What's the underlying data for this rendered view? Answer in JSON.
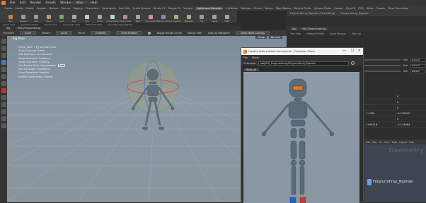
{
  "menubar": {
    "items": [
      "File",
      "Edit",
      "Render",
      "Assets",
      "Windows",
      "Labs",
      "Help"
    ],
    "build": "Build",
    "title": "Main"
  },
  "shelf_tabs": [
    "Create",
    "Modify",
    "Model",
    "Polygon",
    "Deform",
    "Texture",
    "Rigging",
    "Characters",
    "Constraints",
    "Hair Utils",
    "Guide Process",
    "Terrain FX",
    "Simple FX",
    "Volume",
    "Lights and Cameras",
    "Collisions",
    "Particles",
    "Grains",
    "Vellum",
    "Rigid Bodies",
    "Particle Fluids",
    "Viscous Fluids",
    "Oceans",
    "Pyro FX",
    "FEM",
    "Wires",
    "Crowds",
    "Drive Simulation"
  ],
  "shelf_tools": [
    "Box",
    "Sphere",
    "Tube",
    "Torus",
    "Grid",
    "Null",
    "Line",
    "Circle",
    "Curve Bezier",
    "Draw Curve",
    "Path",
    "Spray Paint",
    "Platonic Solids",
    "L-System",
    "Metaball",
    "File",
    "Spiral",
    "Helix"
  ],
  "secondary_tabs": [
    "Scene View",
    "Animation Editor",
    "Render View",
    "Composite View",
    "Motion FX View",
    "Geometry Spreadsheet"
  ],
  "pathbar": {
    "obj": "obj",
    "node": "RIG_Fergrumthrup"
  },
  "toolbar": {
    "translate": "Translate",
    "scale": "Scale",
    "rotate_label": "Rotate",
    "local": "Local",
    "mirror": "Mirror",
    "enabled": "Enabled",
    "pose_multiple": "Pose Multiple",
    "toggle_rotate": "Toggle Rotate Limits",
    "motion_path": "Motion Path",
    "jump_resume": "Jump to Rest/Joint",
    "open_picker": "Open Make Catalog"
  },
  "viewport": {
    "title": "Rig Pose",
    "overlay_lines": [
      "Press [Shift + R] to Reset Pose",
      "Show Channel Scales",
      "Add Keyframe on transform",
      "Show Controller Collisions",
      "Show Controller Visibility",
      "Use Manual Pose Interpolation",
      "Use Constrain Transforms",
      "Show Transform Handles",
      "Enable Subdivisions Display"
    ],
    "highlight": "Pose",
    "persp": "Persp",
    "cam": "No cam"
  },
  "picker": {
    "title": "Houdini Indie Limited-Commercial - Character Picker",
    "menu": [
      "File",
      "Mode"
    ],
    "character_label": "Character",
    "character_path": "/obj/RIG_Fergrumthrup/Fergrumthrup_Rigmain",
    "tab": "Body_all",
    "win_buttons": [
      "—",
      "☐",
      "✕"
    ]
  },
  "right_panel": {
    "tabs": [
      "Fergrumthrup_Rigmain (Formatting)",
      "Fergrumthrup_Rigmain"
    ],
    "path_chips": [
      "obj",
      "RIG_Fergrumthrup"
    ],
    "sub_tabs": [
      "Tree View",
      "Material Palette",
      "Asset Browser",
      "Take List"
    ],
    "params": [
      {
        "label": "Use",
        "value": "Default"
      },
      {
        "label": "Use",
        "value": "Default"
      },
      {
        "label": "Use",
        "value": "Default"
      }
    ],
    "table_rows": [
      [
        "",
        "0"
      ],
      [
        "",
        "0"
      ],
      [
        "",
        "0"
      ],
      [
        "1.4399",
        "-0.135992"
      ],
      [
        "",
        "0"
      ],
      [
        "2799718",
        "-0.174984"
      ]
    ],
    "net_tools": [
      "Add",
      "Edit",
      "Go",
      "View",
      "Tools",
      "Layout",
      "Help"
    ],
    "network_title": "Geometry",
    "node_label": "Fergrumthrup_Rigmain"
  },
  "colors": {
    "accent_orange": "#e87d28",
    "viewport_bg": "#8a96a2",
    "robot_body": "#5e6d7c",
    "robot_visor": "#e0782a",
    "handle_green": "#55aa55"
  }
}
